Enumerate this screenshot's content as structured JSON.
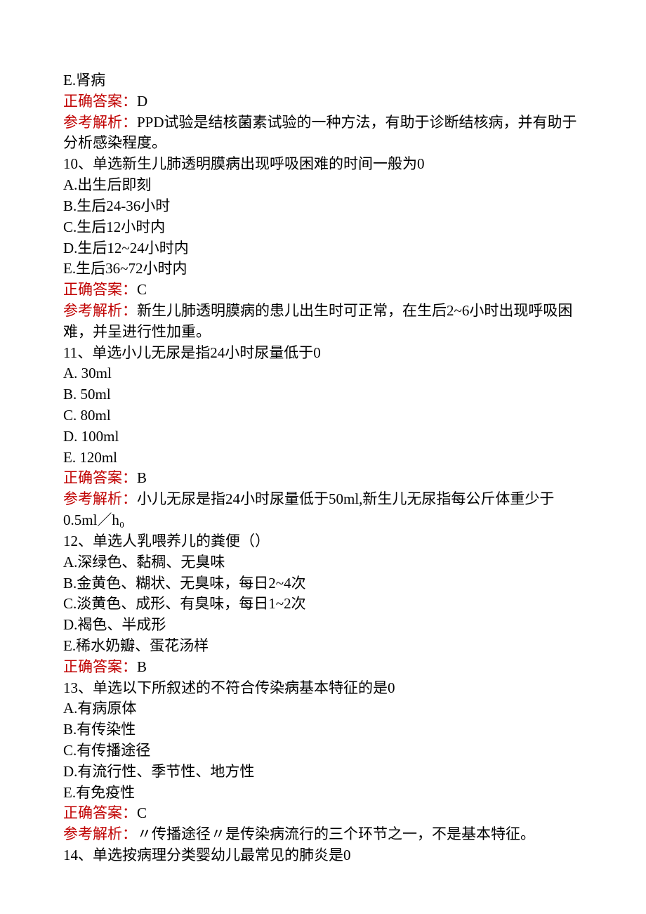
{
  "q9": {
    "optionE": "E.肾病",
    "answer_label": "正确答案：",
    "answer": "D",
    "explain_label": "参考解析：",
    "explain": "PPD试验是结核菌素试验的一种方法，有助于诊断结核病，并有助于分析感染程度。"
  },
  "q10": {
    "stem": "10、单选新生儿肺透明膜病出现呼吸困难的时间一般为0",
    "A": "A.出生后即刻",
    "B": "B.生后24-36小时",
    "C": "C.生后12小时内",
    "D": "D.生后12~24小时内",
    "E": "E.生后36~72小时内",
    "answer_label": "正确答案：",
    "answer": "C",
    "explain_label": "参考解析：",
    "explain": "新生儿肺透明膜病的患儿出生时可正常，在生后2~6小时出现呼吸困难，并呈进行性加重。"
  },
  "q11": {
    "stem": "11、单选小儿无尿是指24小时尿量低于0",
    "A": "A. 30ml",
    "B": "B. 50ml",
    "C": "C. 80ml",
    "D": "D. 100ml",
    "E": "E. 120ml",
    "answer_label": "正确答案：",
    "answer": "B",
    "explain_label": "参考解析：",
    "explain": "小儿无尿是指24小时尿量低于50ml,新生儿无尿指每公斤体重少于0.5ml／h₀"
  },
  "q12": {
    "stem": "12、单选人乳喂养儿的粪便（）",
    "A": "A.深绿色、黏稠、无臭味",
    "B": "B.金黄色、糊状、无臭味，每日2~4次",
    "C": "C.淡黄色、成形、有臭味，每日1~2次",
    "D": "D.褐色、半成形",
    "E": "E.稀水奶瓣、蛋花汤样",
    "answer_label": "正确答案：",
    "answer": "B"
  },
  "q13": {
    "stem": "13、单选以下所叙述的不符合传染病基本特征的是0",
    "A": "A.有病原体",
    "B": "B.有传染性",
    "C": "C.有传播途径",
    "D": "D.有流行性、季节性、地方性",
    "E": "E.有免疫性",
    "answer_label": "正确答案：",
    "answer": "C",
    "explain_label": "参考解析：",
    "explain": "〃传播途径〃是传染病流行的三个环节之一，不是基本特征。"
  },
  "q14": {
    "stem": "14、单选按病理分类婴幼儿最常见的肺炎是0"
  }
}
